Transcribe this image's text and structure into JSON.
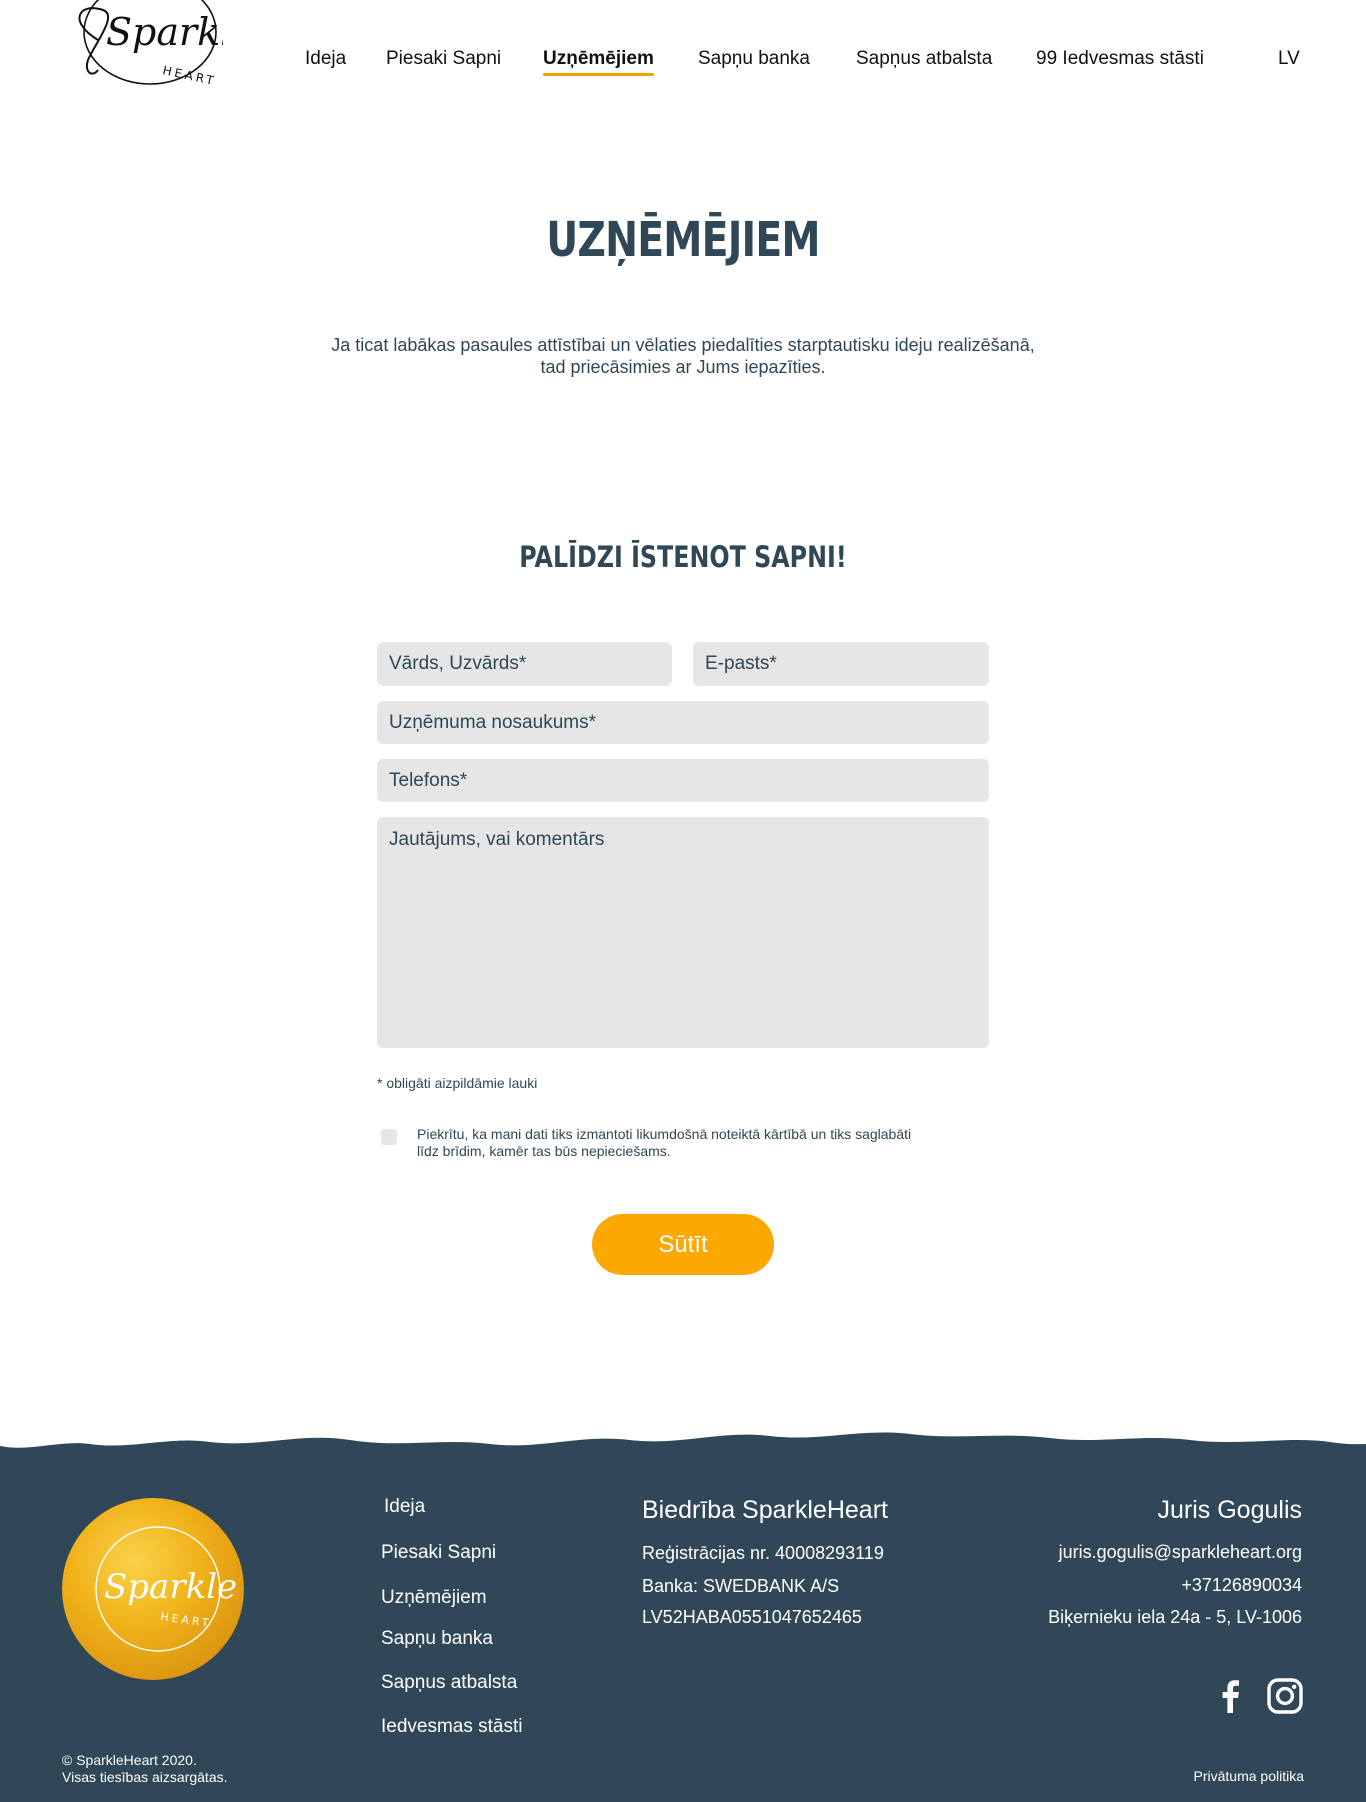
{
  "brand": {
    "logo_text": "Sparkle",
    "logo_sub": "HEART"
  },
  "nav": {
    "items": [
      {
        "label": "Ideja"
      },
      {
        "label": "Piesaki Sapni"
      },
      {
        "label": "Uzņēmējiem"
      },
      {
        "label": "Sapņu banka"
      },
      {
        "label": "Sapņus atbalsta"
      },
      {
        "label": "99 Iedvesmas stāsti"
      },
      {
        "label": "LV"
      }
    ],
    "active_index": 2
  },
  "main": {
    "title": "UZŅĒMĒJIEM",
    "intro_line1": "Ja ticat labākas pasaules attīstībai un vēlaties piedalīties starptautisku ideju realizēšanā,",
    "intro_line2": "tad priecāsimies ar Jums iepazīties.",
    "section_title": "PALĪDZI ĪSTENOT SAPNI!"
  },
  "form": {
    "name_placeholder": "Vārds, Uzvārds*",
    "email_placeholder": "E-pasts*",
    "company_placeholder": "Uzņēmuma nosaukums*",
    "phone_placeholder": "Telefons*",
    "comment_placeholder": "Jautājums, vai komentārs",
    "required_note": "* obligāti aizpildāmie lauki",
    "consent_line1": "Piekrītu, ka mani dati tiks izmantoti likumdošnā noteiktā kārtībā un tiks saglabāti",
    "consent_line2": "līdz brīdim, kamēr tas būs nepieciešams.",
    "submit_label": "Sūtīt"
  },
  "footer": {
    "nav": [
      "Ideja",
      "Piesaki Sapni",
      "Uzņēmējiem",
      "Sapņu banka",
      "Sapņus atbalsta",
      "Iedvesmas stāsti"
    ],
    "org_name": "Biedrība SparkleHeart",
    "reg": "Reģistrācijas nr. 40008293119",
    "bank": "Banka: SWEDBANK A/S",
    "iban": "LV52HABA0551047652465",
    "contact_name": "Juris Gogulis",
    "contact_email": "juris.gogulis@sparkleheart.org",
    "contact_phone": "+37126890034",
    "contact_address": "Biķernieku iela 24a - 5, LV-1006",
    "copyright_line1": "© SparkleHeart 2020.",
    "copyright_line2": "Visas tiesības aizsargātas.",
    "privacy": "Privātuma politika"
  },
  "colors": {
    "accent": "#fca800",
    "dark": "#2f4756",
    "field": "#e6e6e6"
  }
}
